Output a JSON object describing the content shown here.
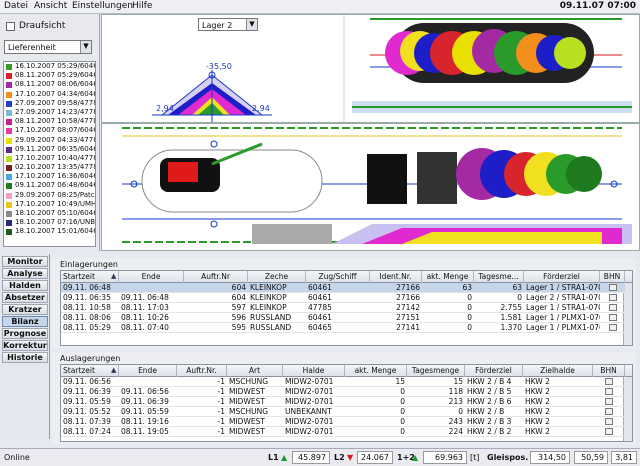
{
  "menu": {
    "items": [
      "Datei",
      "Ansicht",
      "Einstellungen",
      "Hilfe"
    ],
    "clock": "09.11.07 07:00"
  },
  "left": {
    "checkbox_label": "Draufsicht",
    "select_value": "Lieferenheit",
    "list": [
      {
        "text": "16.10.2007 05:29/6046",
        "color": "#3a9a2a"
      },
      {
        "text": "08.11.2007 05:29/6046",
        "color": "#d8242c"
      },
      {
        "text": "08.11.2007 08:06/6046",
        "color": "#a42aa4"
      },
      {
        "text": "17.10.2007 04:34/6046",
        "color": "#f48e1c"
      },
      {
        "text": "27.09.2007 09:58/4778",
        "color": "#2a3ec8"
      },
      {
        "text": "27.09.2007 14:23/4778",
        "color": "#7ab8d8"
      },
      {
        "text": "08.11.2007 10:58/4778",
        "color": "#cc1e8a"
      },
      {
        "text": "17.10.2007 08:07/6046",
        "color": "#e43aa0"
      },
      {
        "text": "29.09.2007 04:33/4778",
        "color": "#e8e000"
      },
      {
        "text": "09.11.2007 06:35/6046",
        "color": "#5b2a8a"
      },
      {
        "text": "17.10.2007 10:40/4778",
        "color": "#b8e020"
      },
      {
        "text": "02.10.2007 13:35/4778",
        "color": "#7a1e1e"
      },
      {
        "text": "17.10.2007 16:36/6046",
        "color": "#4aa8e0"
      },
      {
        "text": "09.11.2007 06:48/6046",
        "color": "#1e7a1e"
      },
      {
        "text": "29.09.2007 08:25/Patc",
        "color": "#f0a0c8"
      },
      {
        "text": "17.10.2007 10:49/UMHA",
        "color": "#e8c818"
      },
      {
        "text": "18.10.2007 05:10/6046",
        "color": "#8a8a8a"
      },
      {
        "text": "18.10.2007 07:16/UNBE",
        "color": "#2a2a7a"
      },
      {
        "text": "18.10.2007 15:01/6046",
        "color": "#1a5a1a"
      }
    ]
  },
  "top": {
    "select_value": "Lager 2",
    "label_top": "-35,50",
    "label_left": "2,94",
    "label_right": "2,94"
  },
  "nav": [
    "Monitor",
    "Analyse",
    "Halden",
    "Absetzer",
    "Kratzer",
    "Bilanz",
    "Prognose",
    "Korrektur",
    "Historie"
  ],
  "nav_active": "Bilanz",
  "ein": {
    "title": "Einlagerungen",
    "headers": [
      "Startzeit",
      "Ende",
      "Auftr.Nr",
      "Zeche",
      "Zug/Schiff",
      "Ident.Nr.",
      "akt. Menge",
      "Tagesme...",
      "Förderziel",
      "BHN"
    ],
    "rows": [
      [
        "09.11. 06:48",
        "",
        "604",
        "KLEINKOP",
        "60461",
        "27166",
        "63",
        "63",
        "Lager 1 / STRA1-0702"
      ],
      [
        "09.11. 06:35",
        "09.11. 06:48",
        "604",
        "KLEINKOP",
        "60461",
        "27166",
        "0",
        "0",
        "Lager 2 / STRA1-0702"
      ],
      [
        "08.11. 10:58",
        "08.11. 17:03",
        "597",
        "KLEINKOP",
        "47785",
        "27142",
        "0",
        "2.755",
        "Lager 1 / STRA1-0702"
      ],
      [
        "08.11. 08:06",
        "08.11. 10:26",
        "596",
        "RUSSLAND",
        "60461",
        "27151",
        "0",
        "1.581",
        "Lager 1 / PLMX1-0701"
      ],
      [
        "08.11. 05:29",
        "08.11. 07:40",
        "595",
        "RUSSLAND",
        "60465",
        "27141",
        "0",
        "1.370",
        "Lager 1 / PLMX1-0701"
      ]
    ]
  },
  "aus": {
    "title": "Auslagerungen",
    "headers": [
      "Startzeit",
      "Ende",
      "Auftr.Nr.",
      "Art",
      "Halde",
      "akt. Menge",
      "Tagesmenge",
      "Förderziel",
      "Zielhalde",
      "BHN"
    ],
    "rows": [
      [
        "09.11. 06:56",
        "",
        "-1",
        "MSCHUNG",
        "MIDW2-0701",
        "15",
        "15",
        "HKW 2 / B 4",
        "HKW 2"
      ],
      [
        "09.11. 06:39",
        "09.11. 06:56",
        "-1",
        "MIDWEST",
        "MIDW2-0701",
        "0",
        "118",
        "HKW 2 / B 5",
        "HKW 2"
      ],
      [
        "09.11. 05:59",
        "09.11. 06:39",
        "-1",
        "MIDWEST",
        "MIDW2-0701",
        "0",
        "213",
        "HKW 2 / B 6",
        "HKW 2"
      ],
      [
        "09.11. 05:52",
        "09.11. 05:59",
        "-1",
        "MSCHUNG",
        "UNBEKANNT",
        "0",
        "0",
        "HKW 2 / B",
        "HKW 2"
      ],
      [
        "08.11. 07:39",
        "08.11. 19:16",
        "-1",
        "MIDWEST",
        "MIDW2-0701",
        "0",
        "243",
        "HKW 2 / B 3",
        "HKW 2"
      ],
      [
        "08.11. 07:24",
        "08.11. 19:05",
        "-1",
        "MIDWEST",
        "MIDW2-0701",
        "0",
        "224",
        "HKW 2 / B 2",
        "HKW 2"
      ]
    ]
  },
  "status": {
    "online": "Online",
    "l1_label": "L1",
    "l1_value": "45.897",
    "l2_label": "L2",
    "l2_value": "24.067",
    "l12_label": "1+2",
    "l12_value": "69.963",
    "unit": "[t]",
    "gleis_label": "Gleispos.",
    "gleis_value": "314,50",
    "v1": "50,59",
    "v2": "3,81"
  }
}
